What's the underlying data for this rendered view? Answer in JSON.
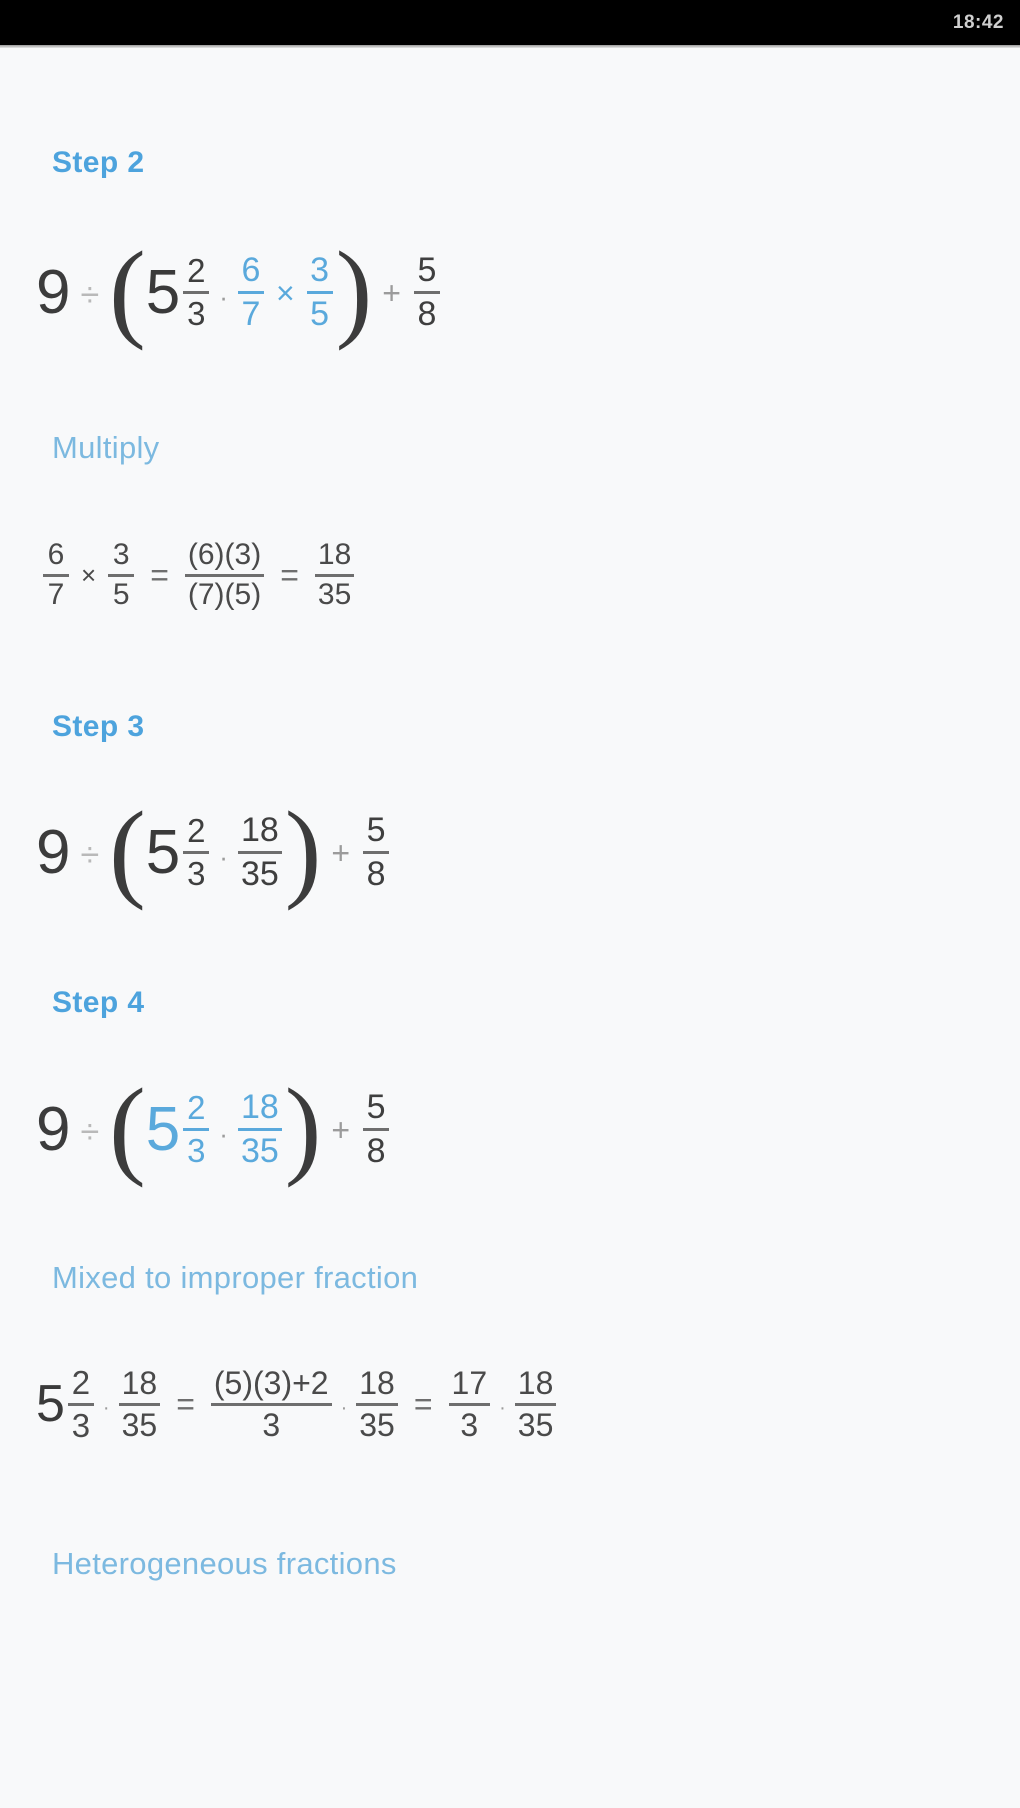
{
  "status_bar": {
    "time": "18:42",
    "background": "#000000"
  },
  "theme": {
    "accent": "#4da3dd",
    "accent_light": "#7cb9e0",
    "text": "#3c3c3c",
    "page_background": "#f8f9fa"
  },
  "sections": [
    {
      "id": "step-2",
      "label": "Step 2",
      "kind": "step",
      "expression_text": "9 ÷ (5 2/3 · 6/7 × 3/5) + 5/8",
      "parts": {
        "whole": "9",
        "div": "÷",
        "open_paren": "(",
        "mixed_whole": "5",
        "mixed_num": "2",
        "mixed_den": "3",
        "dot": "·",
        "frac1_num": "6",
        "frac1_den": "7",
        "times": "×",
        "frac2_num": "3",
        "frac2_den": "5",
        "close_paren": ")",
        "plus": "+",
        "last_num": "5",
        "last_den": "8"
      }
    },
    {
      "id": "multiply",
      "label": "Multiply",
      "kind": "operation",
      "expression_text": "6/7 × 3/5 = (6)(3)/(7)(5) = 18/35",
      "parts": {
        "a_num": "6",
        "a_den": "7",
        "times": "×",
        "b_num": "3",
        "b_den": "5",
        "eq1": "=",
        "prod_num": "(6)(3)",
        "prod_den": "(7)(5)",
        "eq2": "=",
        "res_num": "18",
        "res_den": "35"
      }
    },
    {
      "id": "step-3",
      "label": "Step 3",
      "kind": "step",
      "expression_text": "9 ÷ (5 2/3 · 18/35) + 5/8",
      "parts": {
        "whole": "9",
        "div": "÷",
        "open_paren": "(",
        "mixed_whole": "5",
        "mixed_num": "2",
        "mixed_den": "3",
        "dot": "·",
        "frac_num": "18",
        "frac_den": "35",
        "close_paren": ")",
        "plus": "+",
        "last_num": "5",
        "last_den": "8"
      }
    },
    {
      "id": "step-4",
      "label": "Step 4",
      "kind": "step",
      "expression_text": "9 ÷ (5 2/3 · 18/35) + 5/8",
      "parts": {
        "whole": "9",
        "div": "÷",
        "open_paren": "(",
        "mixed_whole": "5",
        "mixed_num": "2",
        "mixed_den": "3",
        "dot": "·",
        "frac_num": "18",
        "frac_den": "35",
        "close_paren": ")",
        "plus": "+",
        "last_num": "5",
        "last_den": "8"
      }
    },
    {
      "id": "mixed-to-improper",
      "label": "Mixed to improper fraction",
      "kind": "operation",
      "expression_text": "5 2/3 · 18/35 = ((5)(3)+2)/3 · 18/35 = 17/3 · 18/35",
      "parts": {
        "mixed_whole": "5",
        "mixed_num": "2",
        "mixed_den": "3",
        "dot1": "·",
        "f1_num": "18",
        "f1_den": "35",
        "eq1": "=",
        "imp_num": "(5)(3)+2",
        "imp_den": "3",
        "dot2": "·",
        "f2_num": "18",
        "f2_den": "35",
        "eq2": "=",
        "res_num": "17",
        "res_den": "3",
        "dot3": "·",
        "f3_num": "18",
        "f3_den": "35"
      }
    },
    {
      "id": "heterogeneous",
      "label": "Heterogeneous fractions",
      "kind": "operation"
    }
  ]
}
